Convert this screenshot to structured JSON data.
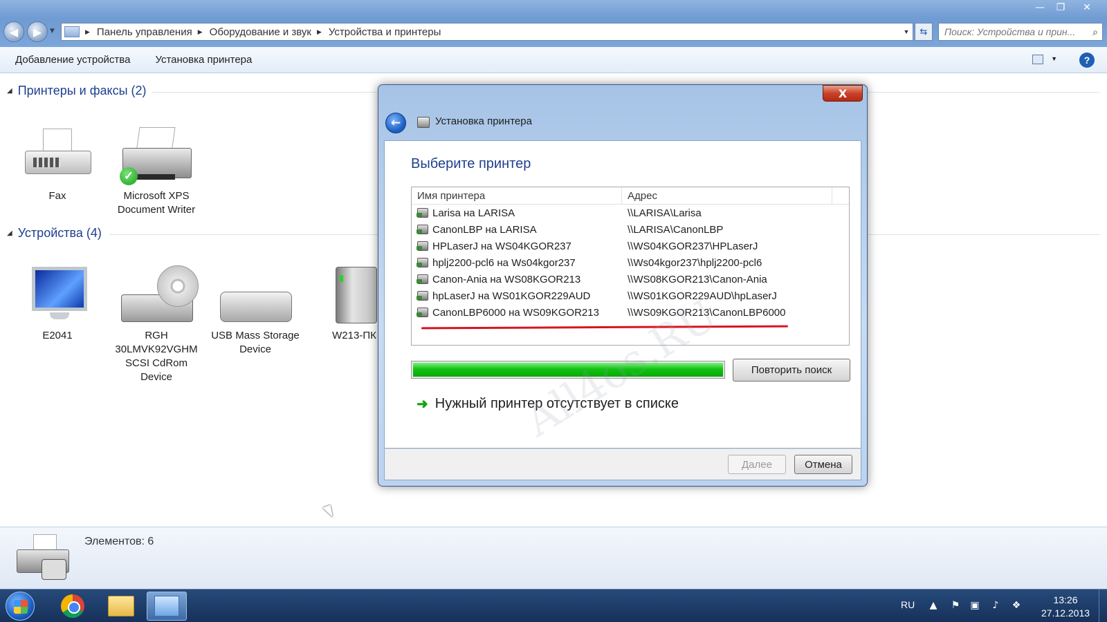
{
  "window": {
    "controls": {
      "minimize": "—",
      "maximize": "❐",
      "close": "✕"
    }
  },
  "address_bar": {
    "crumbs": [
      "Панель управления",
      "Оборудование и звук",
      "Устройства и принтеры"
    ],
    "search_placeholder": "Поиск: Устройства и прин..."
  },
  "command_bar": {
    "add_device": "Добавление устройства",
    "install_printer": "Установка принтера"
  },
  "groups": {
    "printers": {
      "header": "Принтеры и факсы (2)",
      "items": [
        {
          "label": "Fax",
          "icon": "fax-icon"
        },
        {
          "label": "Microsoft XPS Document Writer",
          "icon": "printer-icon",
          "default": true
        }
      ]
    },
    "devices": {
      "header": "Устройства (4)",
      "items": [
        {
          "label": "E2041",
          "icon": "monitor-icon"
        },
        {
          "label": "RGH 30LMVK92VGHM SCSI CdRom Device",
          "icon": "cdrom-drive-icon"
        },
        {
          "label": "USB Mass Storage Device",
          "icon": "usb-drive-icon"
        },
        {
          "label": "W213-ПК",
          "icon": "computer-tower-icon"
        }
      ]
    }
  },
  "status_bar": {
    "count_text": "Элементов: 6"
  },
  "taskbar": {
    "items": [
      "start-button",
      "chrome-icon",
      "explorer-folder-icon",
      "control-panel-icon"
    ],
    "language": "RU",
    "time": "13:26",
    "date": "27.12.2013"
  },
  "dialog": {
    "title": "Установка принтера",
    "close_label": "X",
    "heading": "Выберите принтер",
    "columns": [
      "Имя принтера",
      "Адрес"
    ],
    "printers": [
      {
        "name": "Larisa на LARISA",
        "address": "\\\\LARISA\\Larisa"
      },
      {
        "name": "CanonLBP на LARISA",
        "address": "\\\\LARISA\\CanonLBP"
      },
      {
        "name": "HPLaserJ на WS04KGOR237",
        "address": "\\\\WS04KGOR237\\HPLaserJ"
      },
      {
        "name": "hplj2200-pcl6 на Ws04kgor237",
        "address": "\\\\Ws04kgor237\\hplj2200-pcl6"
      },
      {
        "name": "Canon-Ania на WS08KGOR213",
        "address": "\\\\WS08KGOR213\\Canon-Ania"
      },
      {
        "name": "hpLaserJ на WS01KGOR229AUD",
        "address": "\\\\WS01KGOR229AUD\\hpLaserJ"
      },
      {
        "name": "CanonLBP6000 на WS09KGOR213",
        "address": "\\\\WS09KGOR213\\CanonLBP6000"
      }
    ],
    "progress": 1.0,
    "retry_button": "Повторить поиск",
    "missing_link": "Нужный принтер отсутствует в списке",
    "next_button": "Далее",
    "cancel_button": "Отмена",
    "watermark": "All4os.RU"
  }
}
